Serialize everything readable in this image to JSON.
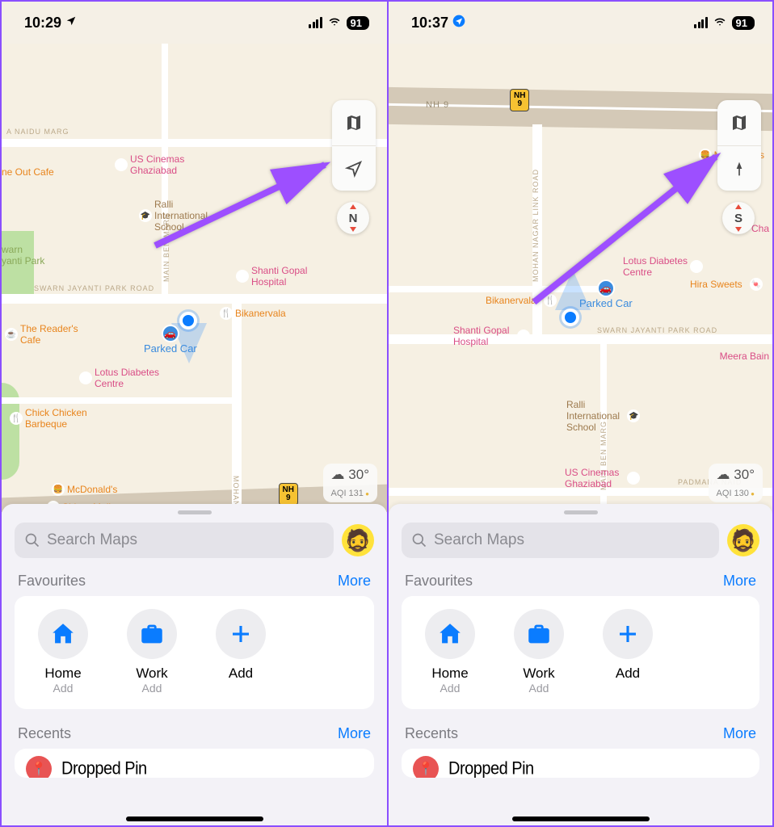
{
  "panes": [
    {
      "status": {
        "time": "10:29",
        "battery": "91",
        "loc_arrow_style": "black"
      },
      "compass": "N",
      "weather": {
        "temp": "30°",
        "aqi": "AQI 131"
      },
      "parked_label": "Parked Car",
      "hw_label": "NH\n9",
      "pois": {
        "us_cinemas": "US Cinemas\nGhaziabad",
        "ralli": "Ralli\nInternational\nSchool",
        "shanti": "Shanti Gopal\nHospital",
        "bikanervala": "Bikanervala",
        "readers": "The Reader's\nCafe",
        "lotus": "Lotus Diabetes\nCentre",
        "chick": "Chick Chicken\nBarbeque",
        "mcd": "McDonald's",
        "shipra": "Shipra Mall",
        "neout": "ne Out Cafe",
        "warn": "warn\nyanti Park"
      },
      "roads": {
        "naidu": "A NAIDU MARG",
        "swarn": "SWARN JAYANTI PARK ROAD",
        "mohan": "MOHAN NAGAR LINK ROAD",
        "ben": "MAIN BEN MARG"
      }
    },
    {
      "status": {
        "time": "10:37",
        "battery": "91",
        "loc_arrow_style": "blue"
      },
      "compass": "S",
      "weather": {
        "temp": "30°",
        "aqi": "AQI 130"
      },
      "parked_label": "Parked Car",
      "hw_label": "NH\n9",
      "pois": {
        "mcd_r": "McDonald's",
        "lotus_r": "Lotus Diabetes\nCentre",
        "hira": "Hira Sweets",
        "bikanervala": "Bikanervala",
        "shanti": "Shanti Gopal\nHospital",
        "meera": "Meera Bain",
        "ralli": "Ralli\nInternational\nSchool",
        "us_cinemas": "US Cinemas\nGhaziabad",
        "cha": "Cha"
      },
      "roads": {
        "mohan": "MOHAN NAGAR LINK ROAD",
        "swarn": "SWARN JAYANTI PARK ROAD",
        "ben": "MAIN BEN MARG",
        "nh9": "NH 9",
        "pad": "PADMANA NAID"
      }
    }
  ],
  "sheet": {
    "search_placeholder": "Search Maps",
    "fav_title": "Favourites",
    "more": "More",
    "recents_title": "Recents",
    "dropped": "Dropped Pin",
    "favs": [
      {
        "label": "Home",
        "sub": "Add",
        "icon": "home"
      },
      {
        "label": "Work",
        "sub": "Add",
        "icon": "briefcase"
      },
      {
        "label": "Add",
        "sub": "",
        "icon": "plus"
      }
    ]
  }
}
